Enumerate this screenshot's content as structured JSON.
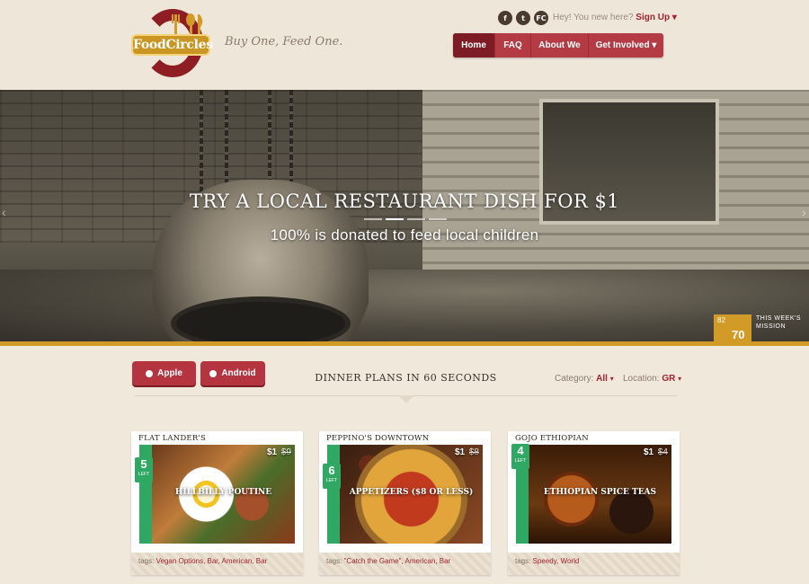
{
  "header": {
    "logo_text": "FoodCircles",
    "tagline": "Buy One, Feed One.",
    "social": [
      {
        "icon": "facebook-icon",
        "glyph": "f"
      },
      {
        "icon": "twitter-icon",
        "glyph": "t"
      },
      {
        "icon": "foodcircles-icon",
        "glyph": "FC"
      }
    ],
    "greeting": "Hey! You new here?",
    "signup": "Sign Up",
    "nav": [
      {
        "label": "Home",
        "active": true
      },
      {
        "label": "FAQ"
      },
      {
        "label": "About We"
      },
      {
        "label": "Get Involved"
      }
    ]
  },
  "hero": {
    "title": "TRY A LOCAL RESTAURANT DISH FOR $1",
    "subtitle": "100% is donated to feed local children",
    "mission": {
      "top": "82",
      "main": "70",
      "label": "THIS WEEK'S MISSION"
    }
  },
  "controls": {
    "apple": "Apple",
    "android": "Android",
    "banner": "DINNER PLANS IN 60 SECONDS",
    "category_label": "Category:",
    "category_value": "All",
    "location_label": "Location:",
    "location_value": "GR"
  },
  "cards": [
    {
      "name": "FLAT LANDER'S",
      "left": "5",
      "left_label": "LEFT",
      "price": "$1",
      "old_price": "$9",
      "dish": "HILLBILLY POUTINE",
      "tags_label": "tags:",
      "tags": "Vegan Options, Bar, American, Bar"
    },
    {
      "name": "PEPPINO'S DOWNTOWN",
      "left": "6",
      "left_label": "LEFT",
      "price": "$1",
      "old_price": "$8",
      "dish": "APPETIZERS ($8 OR LESS)",
      "tags_label": "tags:",
      "tags": "\"Catch the Game\", American, Bar"
    },
    {
      "name": "GOJO ETHIOPIAN",
      "left": "4",
      "left_label": "LEFT",
      "price": "$1",
      "old_price": "$4",
      "dish": "ETHIOPIAN SPICE TEAS",
      "tags_label": "tags:",
      "tags": "Speedy, World"
    }
  ],
  "colors": {
    "brand_red": "#a1232d",
    "brand_gold": "#d29a27",
    "left_green": "#2fa864",
    "background": "#f1e8dc"
  }
}
